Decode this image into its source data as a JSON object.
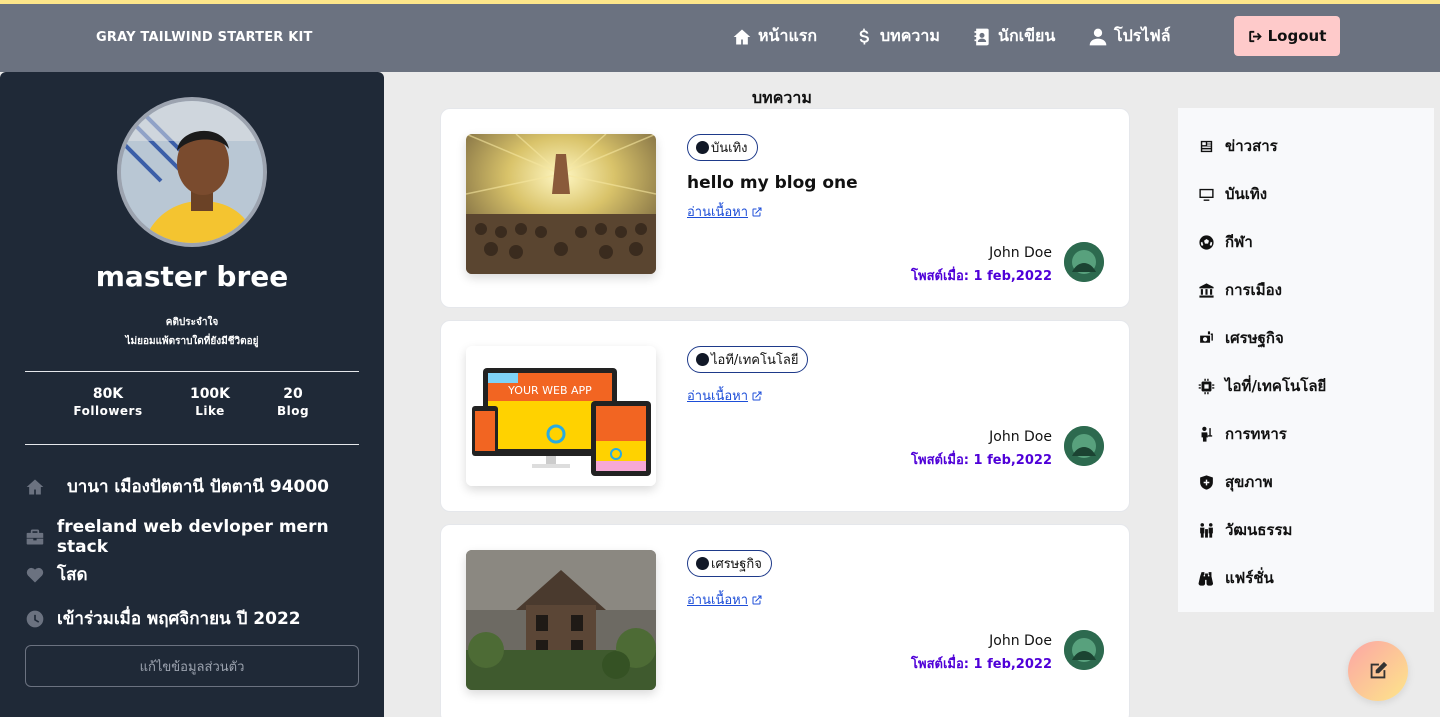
{
  "navbar": {
    "brand": "GRAY TAILWIND STARTER KIT",
    "items": [
      {
        "label": "หน้าแรก",
        "icon": "home-icon"
      },
      {
        "label": "บทความ",
        "icon": "dollar-sign-icon"
      },
      {
        "label": "นักเขียน",
        "icon": "contact-book-icon"
      },
      {
        "label": "โปรไฟล์",
        "icon": "user-icon"
      }
    ],
    "logout_label": "Logout"
  },
  "profile": {
    "name": "master bree",
    "quote_title": "คติประจำใจ",
    "quote_text": "ไม่ยอมแพ้ตราบใดที่ยังมีชีวิตอยู่",
    "stats": [
      {
        "value": "80K",
        "label": "Followers"
      },
      {
        "value": "100K",
        "label": "Like"
      },
      {
        "value": "20",
        "label": "Blog"
      }
    ],
    "address": "บานา เมืองปัตตานี ปัตตานี 94000",
    "job": "freeland web devloper mern stack",
    "status": "โสด",
    "joined": "เข้าร่วมเมื่อ พฤศจิกายน ปี 2022",
    "edit_label": "แก้ไขข้อมูลส่วนตัว"
  },
  "main": {
    "section_title": "บทความ",
    "posts": [
      {
        "tag": "บันเทิง",
        "title": "hello my blog one",
        "read_more": "อ่านเนื้อหา",
        "author": "John Doe",
        "posted": "โพสต์เมื่อ: 1 feb,2022"
      },
      {
        "tag": "ไอที/เทคโนโลยี",
        "title": "",
        "read_more": "อ่านเนื้อหา",
        "author": "John Doe",
        "posted": "โพสต์เมื่อ: 1 feb,2022"
      },
      {
        "tag": "เศรษฐกิจ",
        "title": "",
        "read_more": "อ่านเนื้อหา",
        "author": "John Doe",
        "posted": "โพสต์เมื่อ: 1 feb,2022"
      }
    ],
    "thumb2_text": "YOUR WEB APP"
  },
  "categories": [
    {
      "label": "ข่าวสาร",
      "icon": "newspaper-icon"
    },
    {
      "label": "บันเทิง",
      "icon": "tv-icon"
    },
    {
      "label": "กีฬา",
      "icon": "soccer-ball-icon"
    },
    {
      "label": "การเมือง",
      "icon": "landmark-icon"
    },
    {
      "label": "เศรษฐกิจ",
      "icon": "money-icon"
    },
    {
      "label": "ไอที่/เทคโนโลยี",
      "icon": "chip-icon"
    },
    {
      "label": "การทหาร",
      "icon": "soldier-icon"
    },
    {
      "label": "สุขภาพ",
      "icon": "shield-icon"
    },
    {
      "label": "วัฒนธรรม",
      "icon": "people-icon"
    },
    {
      "label": "แฟร์ชั่น",
      "icon": "binoculars-icon"
    }
  ],
  "fab": {
    "icon": "edit-icon"
  }
}
